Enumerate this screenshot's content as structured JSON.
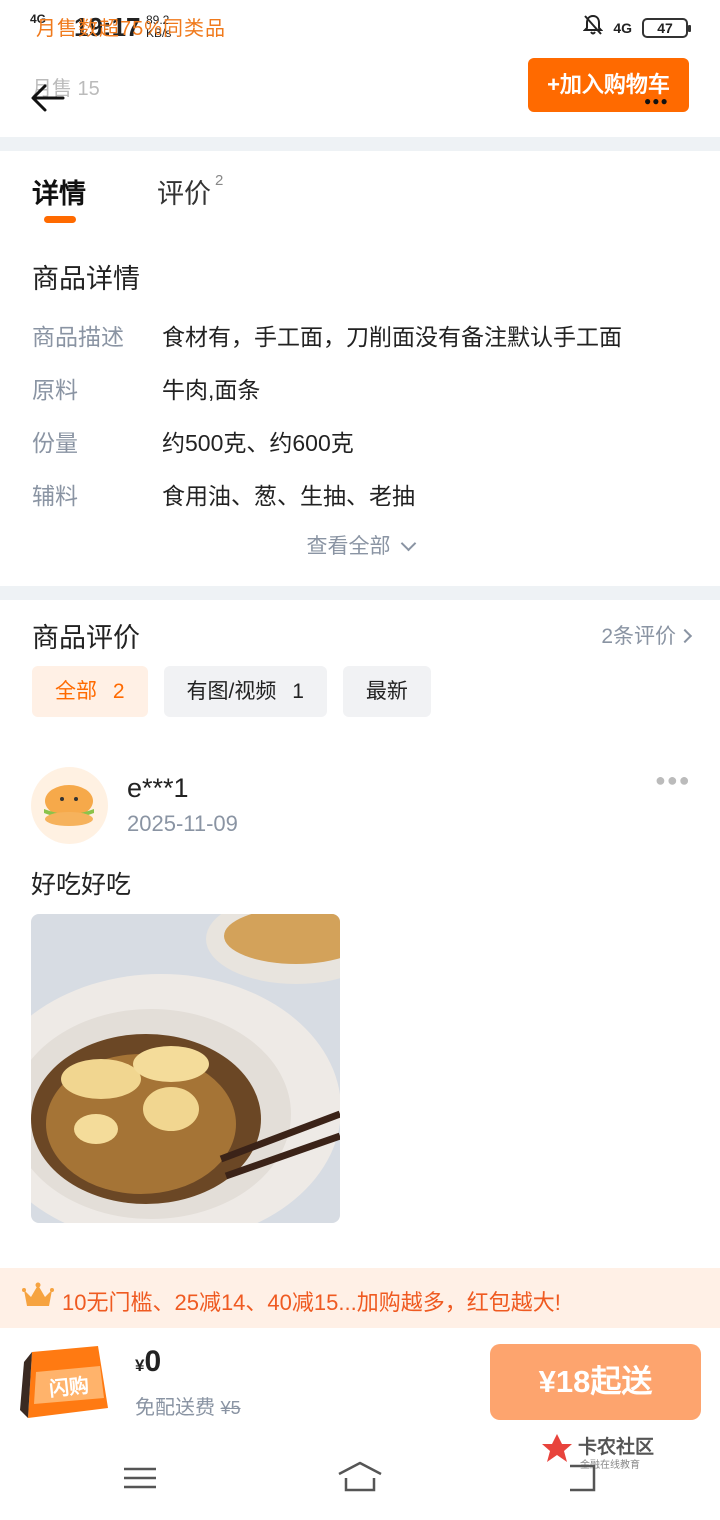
{
  "status_bar": {
    "signal": "4G",
    "time": "19:17",
    "net_speed": "89.2",
    "net_unit": "KB/s",
    "overlay_text": "月售数超75%同类品",
    "network_type": "4G",
    "battery": "47"
  },
  "header": {
    "monthly_sales": "月售 15",
    "add_to_cart": "+加入购物车"
  },
  "tabs": {
    "detail": "详情",
    "reviews": "评价",
    "reviews_count": "2"
  },
  "details": {
    "title": "商品详情",
    "rows": [
      {
        "key": "商品描述",
        "value": "食材有，手工面，刀削面没有备注默认手工面"
      },
      {
        "key": "原料",
        "value": "牛肉,面条"
      },
      {
        "key": "份量",
        "value": "约500克、约600克"
      },
      {
        "key": "辅料",
        "value": "食用油、葱、生抽、老抽"
      }
    ],
    "view_all": "查看全部"
  },
  "reviews": {
    "title": "商品评价",
    "count_link": "2条评价",
    "filters": [
      {
        "label": "全部",
        "count": "2"
      },
      {
        "label": "有图/视频",
        "count": "1"
      },
      {
        "label": "最新",
        "count": ""
      }
    ],
    "items": [
      {
        "user": "e***1",
        "date": "2025-11-09",
        "text": "好吃好吃"
      }
    ]
  },
  "promo": {
    "text": "10无门槛、25减14、40减15...加购越多，红包越大!"
  },
  "cart_bar": {
    "bag_label": "闪购",
    "currency": "¥",
    "price": "0",
    "delivery_label": "免配送费",
    "delivery_original": "¥5",
    "start_button": "¥18起送"
  },
  "watermark": {
    "title": "卡农社区",
    "subtitle": "金融在线教育"
  },
  "colors": {
    "accent": "#ff6a00",
    "start_button": "#fda46e",
    "muted": "#8a94a3",
    "promo_bg": "#fff0e6"
  }
}
